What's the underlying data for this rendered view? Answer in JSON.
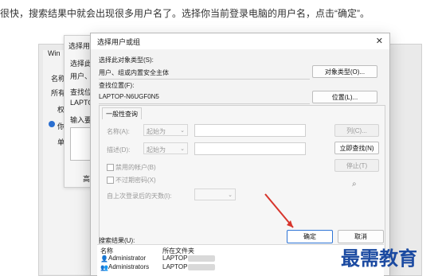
{
  "article": {
    "text": "很快，搜索结果中就会出现很多用户名了。选择你当前登录电脑的用户名，点击“确定”。"
  },
  "bg_window": {
    "tab_text": "Win",
    "win_title": "选择用户",
    "left_items": [
      "名称:",
      "所有者",
      "权",
      "你",
      "单"
    ],
    "select_obj_label": "选择此对",
    "select_obj_value": "用户、组",
    "search_loc_label": "查找位置",
    "search_loc_value": "LAPTOP",
    "enter_label": "输入要选",
    "advanced_btn": "高级"
  },
  "dialog": {
    "title": "选择用户或组",
    "close_icon": "close-icon",
    "object_type_label": "选择此对象类型(S):",
    "object_type_value": "用户、组或内置安全主体",
    "object_type_button": "对象类型(O)...",
    "location_label": "查找位置(F):",
    "location_value": "LAPTOP-N6UGF0N5",
    "location_button": "位置(L)...",
    "tab_label": "一般性查询",
    "name_label": "名称(A):",
    "name_option": "起始为",
    "desc_label": "描述(D):",
    "desc_option": "起始为",
    "disabled_accounts": "禁用的帐户(B)",
    "no_expire_pwd": "不过期密码(X)",
    "days_since_login": "自上次登录后的天数(I):",
    "columns_button": "列(C)...",
    "find_now_button": "立即查找(N)",
    "stop_button": "停止(T)",
    "ok_button": "确定",
    "cancel_button": "取消",
    "results_label": "搜索结果(U):",
    "results_header_name": "名称",
    "results_header_folder": "所在文件夹",
    "results": [
      {
        "name": "Administrator",
        "folder": "LAPTOP"
      },
      {
        "name": "Administrators",
        "folder": "LAPTOP"
      }
    ]
  },
  "watermark": {
    "text": "最需教育"
  },
  "colors": {
    "arrow": "#d7352c",
    "primary_border": "#2f75d6",
    "watermark": "#1b4aa1"
  }
}
